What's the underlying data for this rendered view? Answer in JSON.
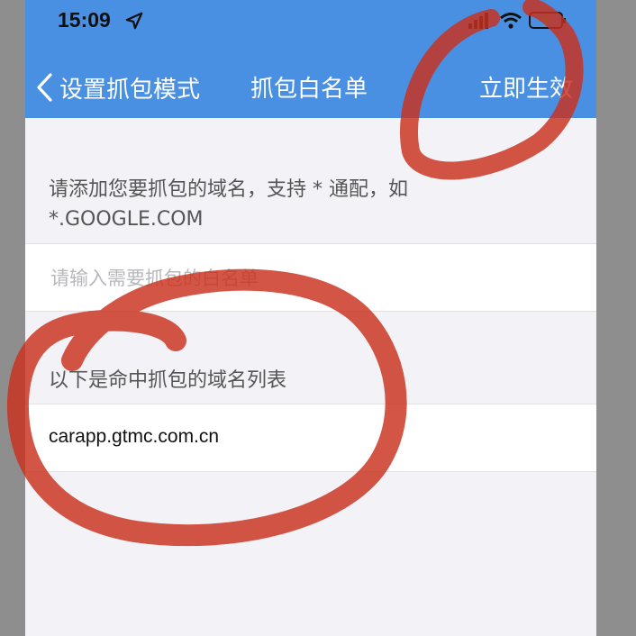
{
  "status_bar": {
    "time": "15:09",
    "icons": [
      "location-arrow-icon",
      "signal-icon",
      "wifi-icon",
      "battery-charging-icon"
    ]
  },
  "nav": {
    "back_label": "设置抓包模式",
    "title": "抓包白名单",
    "action_label": "立即生效"
  },
  "hint": {
    "text": "请添加您要抓包的域名，支持 * 通配，如 *.GOOGLE.COM"
  },
  "whitelist_input": {
    "placeholder": "请输入需要抓包的白名单",
    "value": ""
  },
  "matched": {
    "label": "以下是命中抓包的域名列表",
    "domains": [
      "carapp.gtmc.com.cn"
    ]
  },
  "colors": {
    "nav_bar": "#4a90e2",
    "page_background": "#f2f2f7",
    "annotation": "#c9301c"
  }
}
